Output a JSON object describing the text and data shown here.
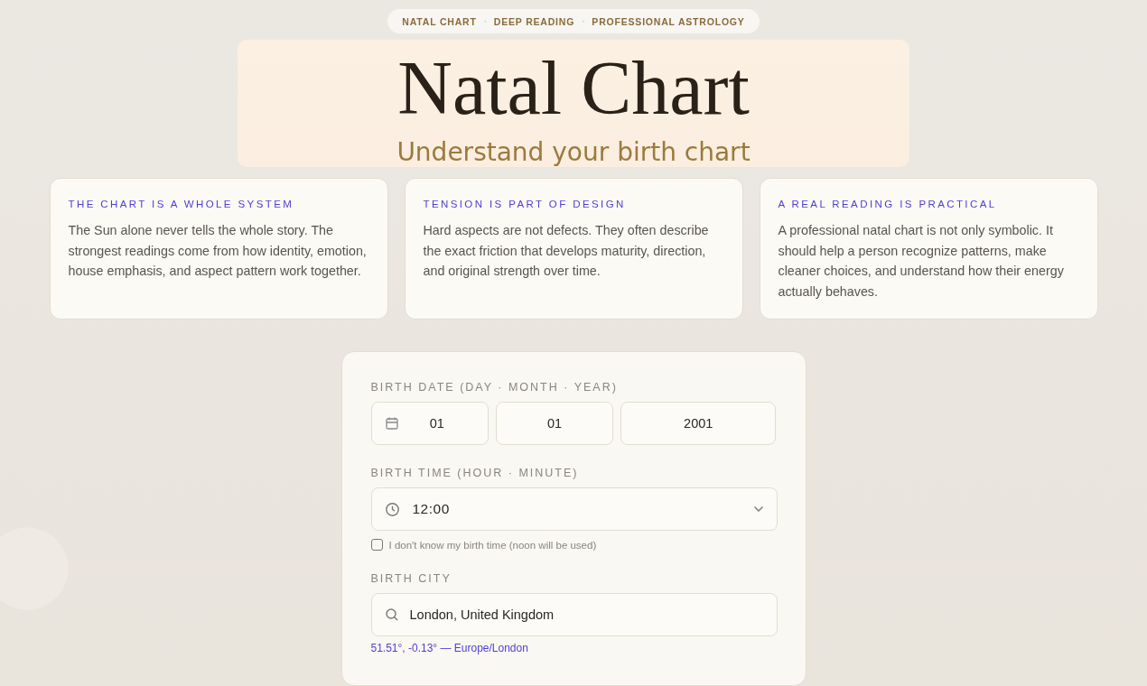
{
  "tagline": [
    "NATAL CHART",
    "·",
    "DEEP READING",
    "·",
    "PROFESSIONAL ASTROLOGY"
  ],
  "hero": {
    "title": "Natal Chart",
    "subtitle": "Understand your birth chart"
  },
  "cards": [
    {
      "heading": "THE CHART IS A WHOLE SYSTEM",
      "body": "The Sun alone never tells the whole story. The strongest readings come from how identity, emotion, house emphasis, and aspect pattern work together."
    },
    {
      "heading": "TENSION IS PART OF DESIGN",
      "body": "Hard aspects are not defects. They often describe the exact friction that develops maturity, direction, and original strength over time."
    },
    {
      "heading": "A REAL READING IS PRACTICAL",
      "body": "A professional natal chart is not only symbolic. It should help a person recognize patterns, make cleaner choices, and understand how their energy actually behaves."
    }
  ],
  "form": {
    "birth_date": {
      "label": "BIRTH DATE (DAY · MONTH · YEAR)",
      "day": "01",
      "month": "01",
      "year": "2001"
    },
    "birth_time": {
      "label": "BIRTH TIME (HOUR · MINUTE)",
      "value": "12:00",
      "unknown_checkbox": {
        "label": "I don't know my birth time (noon will be used)",
        "checked": false
      }
    },
    "birth_city": {
      "label": "BIRTH CITY",
      "value": "London, United Kingdom",
      "coordinates": "51.51°, -0.13° — Europe/London"
    }
  }
}
